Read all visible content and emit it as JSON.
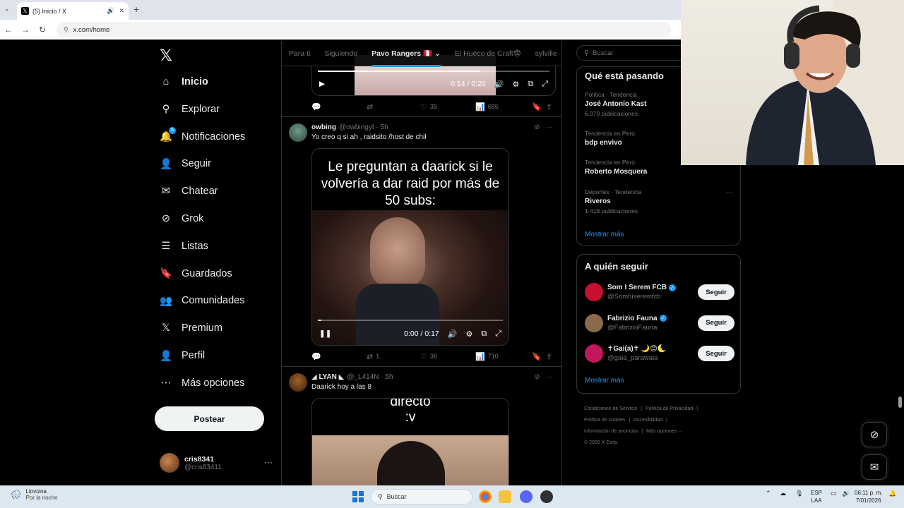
{
  "browser": {
    "tab_title": "(5) Inicio / X",
    "url": "x.com/home"
  },
  "nav": {
    "items": [
      {
        "label": "Inicio",
        "icon": "home-icon",
        "active": true
      },
      {
        "label": "Explorar",
        "icon": "search-icon"
      },
      {
        "label": "Notificaciones",
        "icon": "bell-icon",
        "badge": "5"
      },
      {
        "label": "Seguir",
        "icon": "person-plus-icon"
      },
      {
        "label": "Chatear",
        "icon": "envelope-icon"
      },
      {
        "label": "Grok",
        "icon": "grok-icon"
      },
      {
        "label": "Listas",
        "icon": "list-icon"
      },
      {
        "label": "Guardados",
        "icon": "bookmark-icon"
      },
      {
        "label": "Comunidades",
        "icon": "people-icon"
      },
      {
        "label": "Premium",
        "icon": "x-icon"
      },
      {
        "label": "Perfil",
        "icon": "person-icon"
      },
      {
        "label": "Más opciones",
        "icon": "more-circle-icon"
      }
    ],
    "post_button": "Postear",
    "account": {
      "name": "cris8341",
      "handle": "@cris83411"
    }
  },
  "feed": {
    "tabs": [
      "Para ti",
      "Siguiendo",
      "Pavo Rangers 🇵🇪",
      "El Hueco de Craft😨",
      "sylville"
    ],
    "top_video": {
      "time": "0:14 / 0:20",
      "progress": 0.7
    },
    "top_actions": {
      "reply": "",
      "repost": "",
      "like": "35",
      "views": "685"
    },
    "posts": [
      {
        "name": "owbing",
        "handle": "@owbingyt",
        "time": "5h",
        "text": "Yo creo q si ah , raidsito /host de chil",
        "video_caption": "Le preguntan a daarick si le volvería a dar raid por más de 50 subs:",
        "video_time": "0:00 / 0:17",
        "progress": 0.02,
        "actions": {
          "reply": "",
          "repost": "1",
          "like": "36",
          "views": "710"
        }
      },
      {
        "name": "◢ LYAN ◣",
        "handle": "@_L414N",
        "time": "5h",
        "text": "Daarick hoy a las 8",
        "video_caption": "directo\n:v"
      }
    ]
  },
  "sidebar": {
    "search_placeholder": "Buscar",
    "trends_title": "Qué está pasando",
    "trends": [
      {
        "category": "Política · Tendencia",
        "name": "José Antonio Kast",
        "count": "6.379 publicaciones"
      },
      {
        "category": "Tendencia en Perú",
        "name": "bdp envivo",
        "count": ""
      },
      {
        "category": "Tendencia en Perú",
        "name": "Roberto Mosquera",
        "count": ""
      },
      {
        "category": "Deportes · Tendencia",
        "name": "Riveros",
        "count": "1.418 publicaciones"
      }
    ],
    "show_more": "Mostrar más",
    "who_title": "A quién seguir",
    "who": [
      {
        "name": "Som I Serem FCB",
        "handle": "@Somhiseremfcb",
        "verified": true,
        "color": "#c8102e"
      },
      {
        "name": "Fabrizio Fauna",
        "handle": "@FabrizioFauna",
        "verified": true,
        "color": "#8b6a4a"
      },
      {
        "name": "✝Gai(a)✝ 🌙😊🌜",
        "handle": "@gaia_parawaia",
        "verified": false,
        "color": "#c2185b"
      }
    ],
    "follow_label": "Seguir",
    "show_more2": "Mostrar más",
    "footer": [
      "Condiciones de Servicio",
      "|",
      "Política de Privacidad",
      "|",
      "Política de cookies",
      "|",
      "Accesibilidad",
      "|",
      "Información de anuncios",
      "|",
      "Más opciones ···",
      "© 2026 X Corp."
    ]
  },
  "taskbar": {
    "weather_title": "Llovizna",
    "weather_sub": "Por la noche",
    "search": "Buscar",
    "lang1": "ESP",
    "lang2": "LAA",
    "time": "06:11 p. m.",
    "date": "7/01/2026"
  },
  "colors": {
    "accent": "#1d9bf0",
    "background": "#000000",
    "border": "#2f3336"
  }
}
